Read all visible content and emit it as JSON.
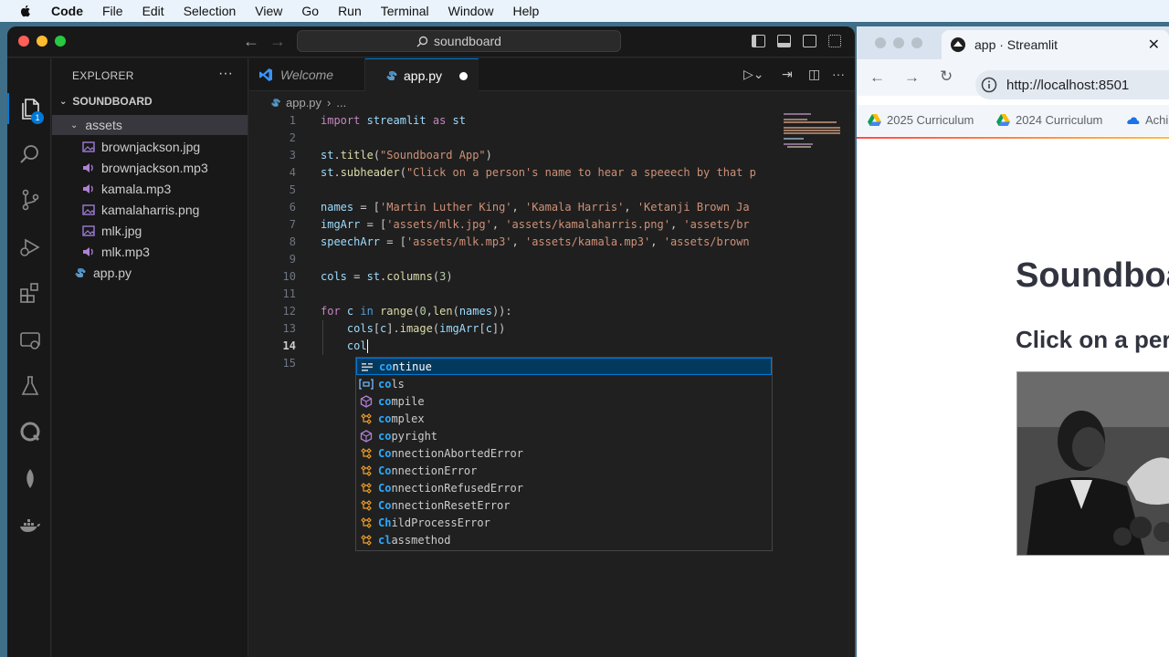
{
  "menubar": {
    "items": [
      "Code",
      "File",
      "Edit",
      "Selection",
      "View",
      "Go",
      "Run",
      "Terminal",
      "Window",
      "Help"
    ]
  },
  "vscode": {
    "command_center": "soundboard",
    "explorer": {
      "title": "EXPLORER",
      "project": "SOUNDBOARD",
      "folder": "assets",
      "files": [
        {
          "name": "brownjackson.jpg",
          "type": "image"
        },
        {
          "name": "brownjackson.mp3",
          "type": "audio"
        },
        {
          "name": "kamala.mp3",
          "type": "audio"
        },
        {
          "name": "kamalaharris.png",
          "type": "image"
        },
        {
          "name": "mlk.jpg",
          "type": "image"
        },
        {
          "name": "mlk.mp3",
          "type": "audio"
        }
      ],
      "root_file": "app.py",
      "badge": "1"
    },
    "tabs": [
      {
        "label": "Welcome",
        "active": false
      },
      {
        "label": "app.py",
        "active": true,
        "dirty": true
      }
    ],
    "breadcrumb": {
      "file": "app.py",
      "more": "..."
    },
    "code": {
      "line_numbers": [
        "1",
        "2",
        "3",
        "4",
        "5",
        "6",
        "7",
        "8",
        "9",
        "10",
        "11",
        "12",
        "13",
        "14",
        "15"
      ],
      "current_line": "14",
      "lines": [
        "import streamlit as st",
        "",
        "st.title(\"Soundboard App\")",
        "st.subheader(\"Click on a person's name to hear a speeech by that p",
        "",
        "names = ['Martin Luther King', 'Kamala Harris', 'Ketanji Brown Ja",
        "imgArr = ['assets/mlk.jpg', 'assets/kamalaharris.png', 'assets/br",
        "speechArr = ['assets/mlk.mp3', 'assets/kamala.mp3', 'assets/brown",
        "",
        "cols = st.columns(3)",
        "",
        "for c in range(0,len(names)):",
        "    cols[c].image(imgArr[c])",
        "    col",
        ""
      ]
    },
    "suggestions": {
      "typed_prefix": "co",
      "items": [
        {
          "label": "continue",
          "kind": "keyword",
          "selected": true
        },
        {
          "label": "cols",
          "kind": "variable"
        },
        {
          "label": "compile",
          "kind": "function"
        },
        {
          "label": "complex",
          "kind": "class"
        },
        {
          "label": "copyright",
          "kind": "function"
        },
        {
          "label": "ConnectionAbortedError",
          "kind": "class"
        },
        {
          "label": "ConnectionError",
          "kind": "class"
        },
        {
          "label": "ConnectionRefusedError",
          "kind": "class"
        },
        {
          "label": "ConnectionResetError",
          "kind": "class"
        },
        {
          "label": "ChildProcessError",
          "kind": "class"
        },
        {
          "label": "classmethod",
          "kind": "class"
        }
      ]
    }
  },
  "browser": {
    "tab_title": "app · Streamlit",
    "url": "http://localhost:8501",
    "bookmarks": [
      "2025 Curriculum",
      "2024 Curriculum",
      "Achi"
    ],
    "page": {
      "title": "Soundboard App",
      "subheader": "Click on a person's name to hear a speeech by that p"
    }
  },
  "colors": {
    "accent": "#0078d4",
    "editor_bg": "#1f1f1f",
    "keyword": "#c586c0",
    "string": "#ce9178",
    "function": "#dcdcaa",
    "match_highlight": "#2aaaff"
  }
}
